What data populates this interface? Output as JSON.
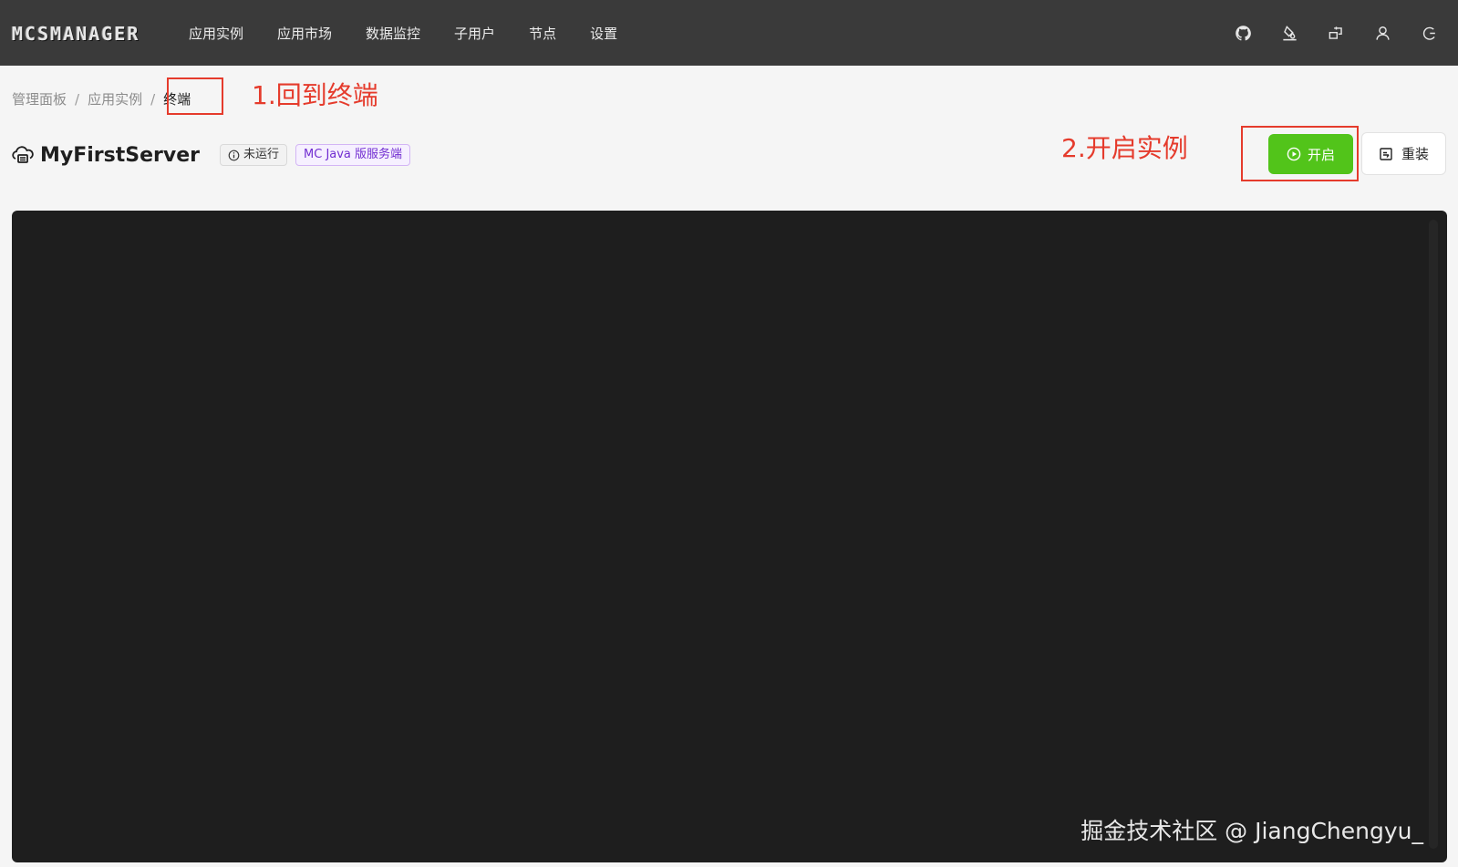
{
  "app": {
    "logo_text": "MCSMANAGER"
  },
  "nav": {
    "items": [
      {
        "label": "应用实例"
      },
      {
        "label": "应用市场"
      },
      {
        "label": "数据监控"
      },
      {
        "label": "子用户"
      },
      {
        "label": "节点"
      },
      {
        "label": "设置"
      }
    ]
  },
  "top_icons": [
    "github-icon",
    "theme-icon",
    "language-icon",
    "user-icon",
    "logout-icon"
  ],
  "breadcrumb": {
    "items": [
      "管理面板",
      "应用实例",
      "终端"
    ],
    "separator": "/"
  },
  "annotations": {
    "step1": "1.回到终端",
    "step2": "2.开启实例",
    "color": "#e53b2c"
  },
  "instance": {
    "name": "MyFirstServer",
    "status": "未运行",
    "type": "MC Java 版服务端"
  },
  "actions": {
    "start_label": "开启",
    "reinstall_label": "重装"
  },
  "terminal": {
    "watermark": "掘金技术社区 @ JiangChengyu_"
  },
  "colors": {
    "topbar": "#3a3a3a",
    "start_button": "#52c41a",
    "terminal_bg": "#1e1e1e",
    "type_tag": "#722ed1"
  }
}
